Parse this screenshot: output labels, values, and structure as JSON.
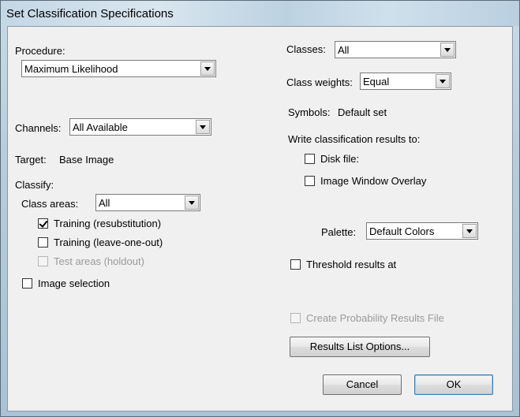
{
  "window": {
    "title": "Set Classification Specifications"
  },
  "left": {
    "procedure_label": "Procedure:",
    "procedure_value": "Maximum Likelihood",
    "channels_label": "Channels:",
    "channels_value": "All Available",
    "target_label": "Target:",
    "target_value": "Base Image",
    "classify_label": "Classify:",
    "class_areas_label": "Class areas:",
    "class_areas_value": "All",
    "training_resub": "Training (resubstitution)",
    "training_loo": "Training (leave-one-out)",
    "test_areas": "Test areas (holdout)",
    "image_selection": "Image selection"
  },
  "right": {
    "classes_label": "Classes:",
    "classes_value": "All",
    "class_weights_label": "Class weights:",
    "class_weights_value": "Equal",
    "symbols_label": "Symbols:",
    "symbols_value": "Default set",
    "write_results_label": "Write classification results to:",
    "disk_file": "Disk file:",
    "image_window_overlay": "Image Window Overlay",
    "palette_label": "Palette:",
    "palette_value": "Default Colors",
    "threshold_label": "Threshold results at",
    "create_prob_file": "Create Probability Results File",
    "results_list_options": "Results List Options..."
  },
  "buttons": {
    "cancel": "Cancel",
    "ok": "OK"
  }
}
